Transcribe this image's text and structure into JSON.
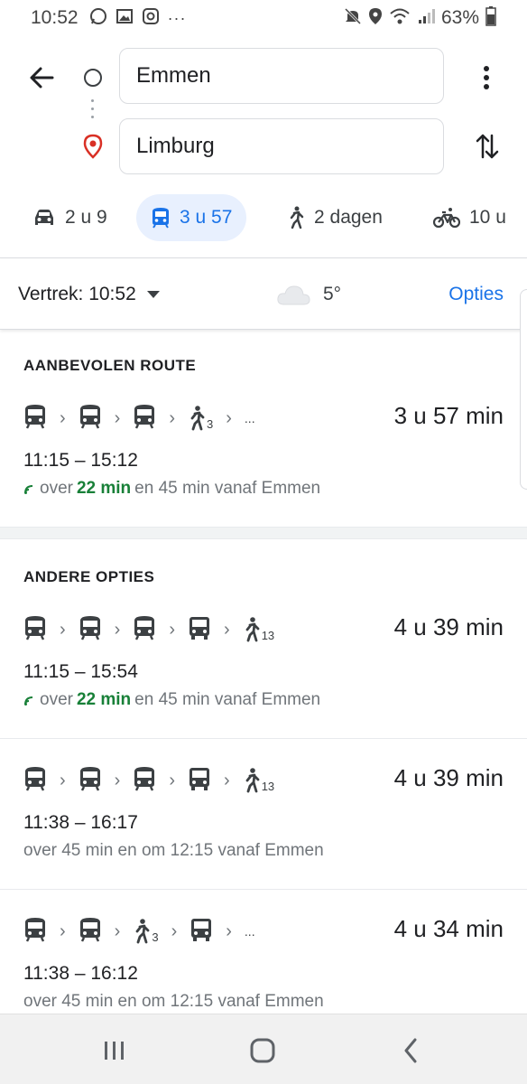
{
  "status_bar": {
    "time": "10:52",
    "battery": "63%"
  },
  "search": {
    "origin": "Emmen",
    "destination": "Limburg"
  },
  "modes": [
    {
      "name": "car",
      "label": "2 u 9"
    },
    {
      "name": "transit",
      "label": "3 u 57"
    },
    {
      "name": "walk",
      "label": "2 dagen"
    },
    {
      "name": "bike",
      "label": "10 u"
    }
  ],
  "options_bar": {
    "depart": "Vertrek: 10:52",
    "temperature": "5°",
    "options": "Opties"
  },
  "recommended": {
    "title": "AANBEVOLEN ROUTE",
    "route": {
      "duration": "3 u 57 min",
      "times": "11:15 – 15:12",
      "status_pre": "over",
      "status_highlight": "22 min",
      "status_post": "en 45 min vanaf Emmen",
      "walk_min": "3"
    }
  },
  "other": {
    "title": "ANDERE OPTIES",
    "routes": [
      {
        "duration": "4 u 39 min",
        "times": "11:15 – 15:54",
        "status_pre": "over",
        "status_highlight": "22 min",
        "status_post": "en 45 min vanaf Emmen",
        "walk_min": "13"
      },
      {
        "duration": "4 u 39 min",
        "times": "11:38 – 16:17",
        "status": "over 45 min en om 12:15 vanaf Emmen",
        "walk_min": "13"
      },
      {
        "duration": "4 u 34 min",
        "times": "11:38 – 16:12",
        "status": "over 45 min en om 12:15 vanaf Emmen",
        "walk_min": "3"
      }
    ]
  },
  "ellipsis": "..."
}
